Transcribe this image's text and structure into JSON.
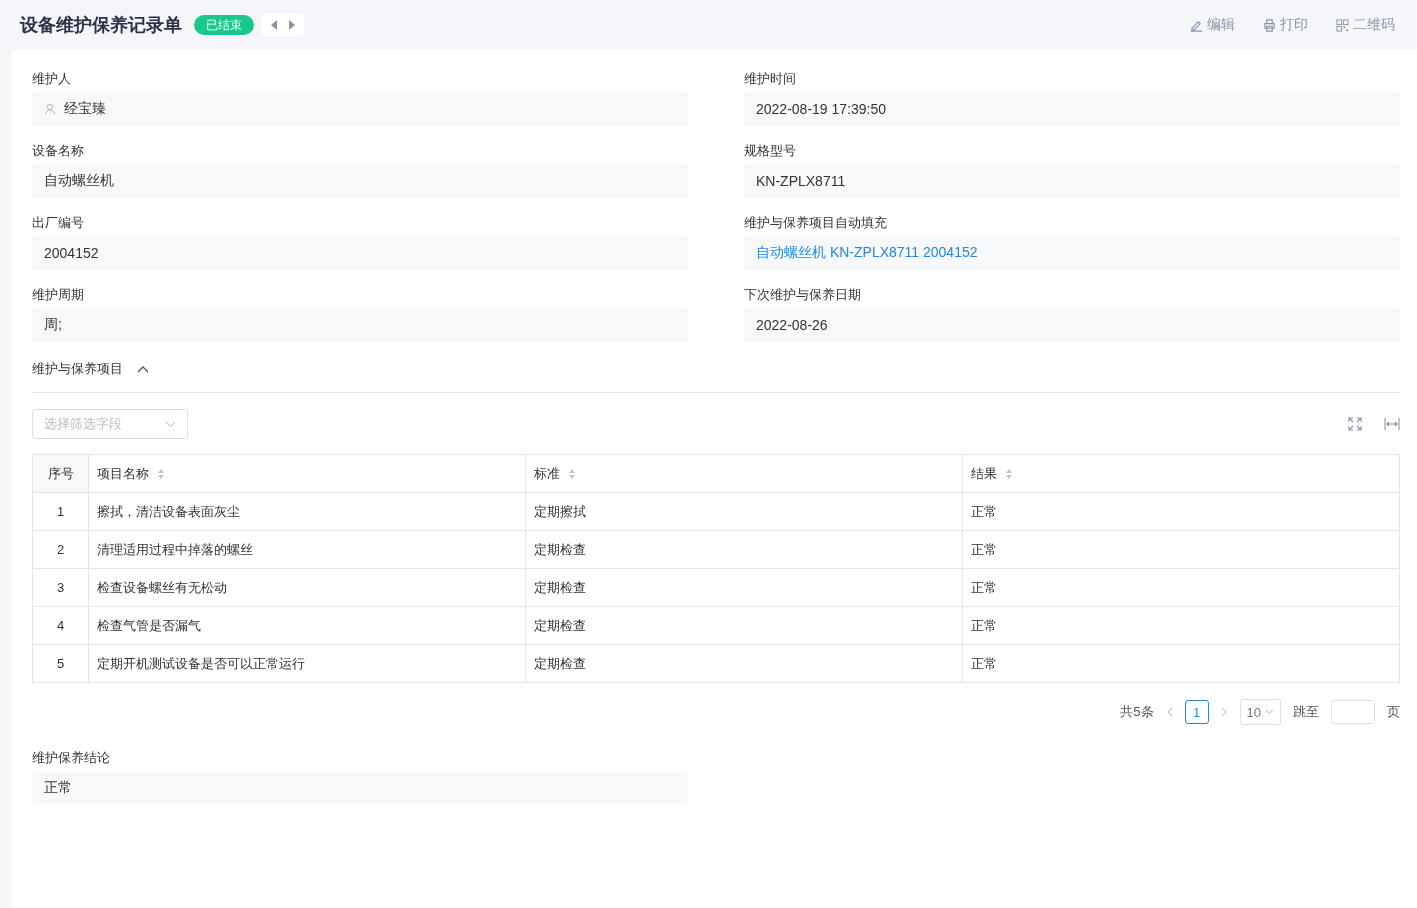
{
  "header": {
    "title": "设备维护保养记录单",
    "status": "已结束",
    "actions": [
      {
        "kind": "edit",
        "label": "编辑"
      },
      {
        "kind": "print",
        "label": "打印"
      },
      {
        "kind": "qrcode",
        "label": "二维码"
      }
    ]
  },
  "fields": [
    {
      "label": "维护人",
      "value": "经宝臻",
      "kind": "person"
    },
    {
      "label": "维护时间",
      "value": "2022-08-19 17:39:50",
      "kind": "text"
    },
    {
      "label": "设备名称",
      "value": "自动螺丝机",
      "kind": "text"
    },
    {
      "label": "规格型号",
      "value": "KN-ZPLX8711",
      "kind": "text"
    },
    {
      "label": "出厂编号",
      "value": "2004152",
      "kind": "text"
    },
    {
      "label": "维护与保养项目自动填充",
      "value": "自动螺丝机 KN-ZPLX8711 2004152",
      "kind": "link"
    },
    {
      "label": "维护周期",
      "value": "周;",
      "kind": "text"
    },
    {
      "label": "下次维护与保养日期",
      "value": "2022-08-26",
      "kind": "text"
    }
  ],
  "section": {
    "title": "维护与保养项目",
    "expanded": true,
    "filter_placeholder": "选择筛选字段"
  },
  "table": {
    "columns": [
      {
        "label": "序号",
        "sortable": false
      },
      {
        "label": "项目名称",
        "sortable": true
      },
      {
        "label": "标准",
        "sortable": true
      },
      {
        "label": "结果",
        "sortable": true
      }
    ],
    "rows": [
      [
        "1",
        "擦拭，清洁设备表面灰尘",
        "定期擦拭",
        "正常"
      ],
      [
        "2",
        "清理适用过程中掉落的螺丝",
        "定期检查",
        "正常"
      ],
      [
        "3",
        "检查设备螺丝有无松动",
        "定期检查",
        "正常"
      ],
      [
        "4",
        "检查气管是否漏气",
        "定期检查",
        "正常"
      ],
      [
        "5",
        "定期开机测试设备是否可以正常运行",
        "定期检查",
        "正常"
      ]
    ]
  },
  "pagination": {
    "total": "共5条",
    "pages": [
      {
        "label": "1",
        "selected": true
      }
    ],
    "page_size": "10",
    "jump_label": "跳至",
    "page_suffix": "页"
  },
  "conclusion": {
    "label": "维护保养结论",
    "value": "正常"
  }
}
